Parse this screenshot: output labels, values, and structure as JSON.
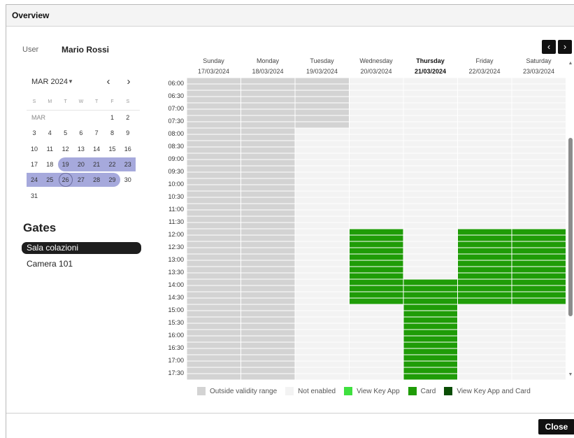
{
  "window": {
    "title": "Overview"
  },
  "user": {
    "label": "User",
    "name": "Mario Rossi"
  },
  "calendar": {
    "title": "MAR 2024",
    "caret_icon": "chevron-down-icon",
    "prev_icon": "chevron-left-icon",
    "next_icon": "chevron-right-icon",
    "weekdays": [
      "S",
      "M",
      "T",
      "W",
      "T",
      "F",
      "S"
    ],
    "month_label": "MAR",
    "weeks": [
      [
        "",
        "",
        "",
        "",
        "",
        "1",
        "2"
      ],
      [
        "3",
        "4",
        "5",
        "6",
        "7",
        "8",
        "9"
      ],
      [
        "10",
        "11",
        "12",
        "13",
        "14",
        "15",
        "16"
      ],
      [
        "17",
        "18",
        "19",
        "20",
        "21",
        "22",
        "23"
      ],
      [
        "24",
        "25",
        "26",
        "27",
        "28",
        "29",
        "30"
      ],
      [
        "31",
        "",
        "",
        "",
        "",
        "",
        ""
      ]
    ],
    "selected_range": [
      "19",
      "29"
    ],
    "today": "26"
  },
  "gates": {
    "title": "Gates",
    "items": [
      {
        "label": "Sala colazioni",
        "active": true
      },
      {
        "label": "Camera 101",
        "active": false
      }
    ]
  },
  "schedule": {
    "prev_icon": "chevron-left-icon",
    "next_icon": "chevron-right-icon",
    "days": [
      {
        "name": "Sunday",
        "date": "17/03/2024",
        "today": false
      },
      {
        "name": "Monday",
        "date": "18/03/2024",
        "today": false
      },
      {
        "name": "Tuesday",
        "date": "19/03/2024",
        "today": false
      },
      {
        "name": "Wednesday",
        "date": "20/03/2024",
        "today": false
      },
      {
        "name": "Thursday",
        "date": "21/03/2024",
        "today": true
      },
      {
        "name": "Friday",
        "date": "22/03/2024",
        "today": false
      },
      {
        "name": "Saturday",
        "date": "23/03/2024",
        "today": false
      }
    ],
    "times": [
      "06:00",
      "06:30",
      "07:00",
      "07:30",
      "08:00",
      "08:30",
      "09:00",
      "09:30",
      "10:00",
      "10:30",
      "11:00",
      "11:30",
      "12:00",
      "12:30",
      "13:00",
      "13:30",
      "14:00",
      "14:30",
      "15:00",
      "15:30",
      "16:00",
      "16:30",
      "17:00",
      "17:30"
    ],
    "states": {
      "outside": "#d3d3d3",
      "not_enabled": "#f3f3f3",
      "view_key_app": "#3fe03f",
      "card": "#1f9c07",
      "view_key_app_and_card": "#0a4d05"
    },
    "day_cells": [
      {
        "outside_all": true
      },
      {
        "outside_all": true
      },
      {
        "outside_until": "08:00"
      },
      {
        "card": [
          "12:00",
          "14:30"
        ]
      },
      {
        "card": [
          "14:00",
          "17:30"
        ]
      },
      {
        "card": [
          "12:00",
          "14:30"
        ]
      },
      {
        "card": [
          "12:00",
          "14:30"
        ]
      }
    ]
  },
  "legend": [
    {
      "label": "Outside validity range",
      "color": "#d3d3d3"
    },
    {
      "label": "Not enabled",
      "color": "#f3f3f3"
    },
    {
      "label": "View Key App",
      "color": "#3fe03f"
    },
    {
      "label": "Card",
      "color": "#1f9c07"
    },
    {
      "label": "View Key App and Card",
      "color": "#0a4d05"
    }
  ],
  "footer": {
    "close_label": "Close"
  },
  "scrollbar": {
    "up_icon": "triangle-up-icon",
    "down_icon": "triangle-down-icon"
  }
}
